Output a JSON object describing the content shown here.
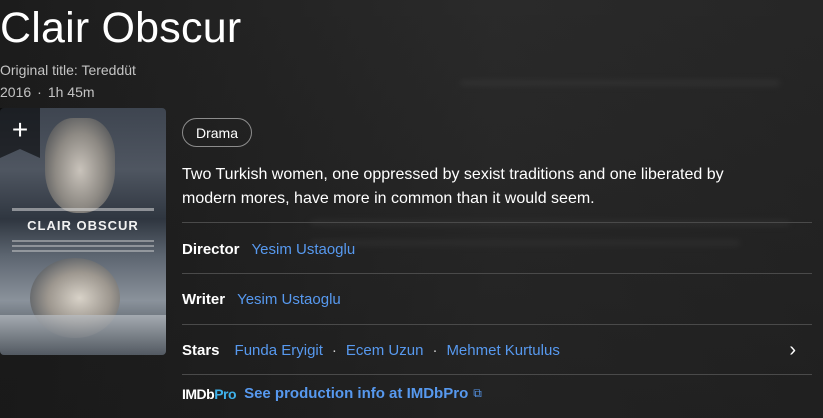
{
  "title": "Clair Obscur",
  "original_title": "Original title: Tereddüt",
  "year": "2016",
  "meta_separator": "·",
  "runtime": "1h 45m",
  "add_button_glyph": "+",
  "poster": {
    "title_text": "CLAIR OBSCUR"
  },
  "genres": [
    "Drama"
  ],
  "plot": "Two Turkish women, one oppressed by sexist traditions and one liberated by modern mores, have more in common than it would seem.",
  "credits": {
    "director_label": "Director",
    "director": "Yesim Ustaoglu",
    "writer_label": "Writer",
    "writer": "Yesim Ustaoglu",
    "stars_label": "Stars",
    "stars": [
      "Funda Eryigit",
      "Ecem Uzun",
      "Mehmet Kurtulus"
    ],
    "star_separator": "·",
    "chevron_glyph": "›"
  },
  "imdbpro": {
    "logo_white": "IMDb",
    "logo_blue": "Pro",
    "link_text": "See production info at IMDbPro",
    "external_icon": "⧉"
  },
  "colors": {
    "link": "#5799ef",
    "imdbpro_blue": "#3fb1ea"
  }
}
